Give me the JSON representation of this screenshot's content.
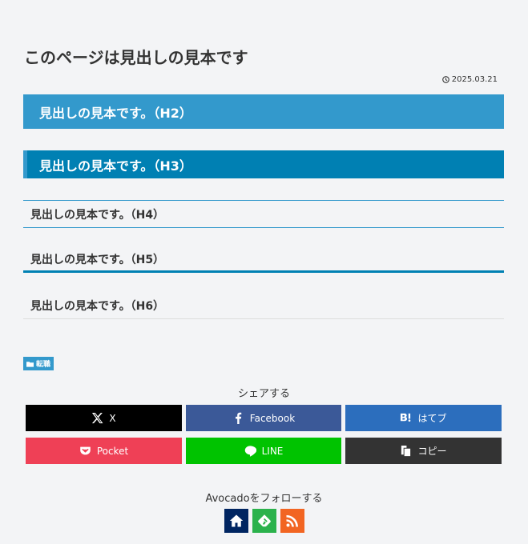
{
  "article": {
    "title": "このページは見出しの見本です",
    "date": "2025.03.21",
    "h2": "見出しの見本です。（H2）",
    "h3": "見出しの見本です。（H3）",
    "h4": "見出しの見本です。（H4）",
    "h5": "見出しの見本です。（H5）",
    "h6": "見出しの見本です。（H6）",
    "category": "転職"
  },
  "share": {
    "title": "シェアする",
    "buttons": [
      {
        "label": "X",
        "icon": "x-icon",
        "color": "#000000"
      },
      {
        "label": "Facebook",
        "icon": "facebook-icon",
        "color": "#3b5998"
      },
      {
        "label": "はてブ",
        "icon": "hatebu-icon",
        "color": "#2c6ebd"
      },
      {
        "label": "Pocket",
        "icon": "pocket-icon",
        "color": "#ef4056"
      },
      {
        "label": "LINE",
        "icon": "line-icon",
        "color": "#00c300"
      },
      {
        "label": "コピー",
        "icon": "copy-icon",
        "color": "#333333"
      }
    ]
  },
  "follow": {
    "title": "Avocadoをフォローする",
    "buttons": [
      {
        "icon": "home-icon",
        "color": "#002561"
      },
      {
        "icon": "feedly-icon",
        "color": "#2bb24c"
      },
      {
        "icon": "rss-icon",
        "color": "#f26522"
      }
    ]
  },
  "colors": {
    "accent": "#3399cc",
    "accent_dark": "#0080b3",
    "background": "#f3f4f6"
  }
}
